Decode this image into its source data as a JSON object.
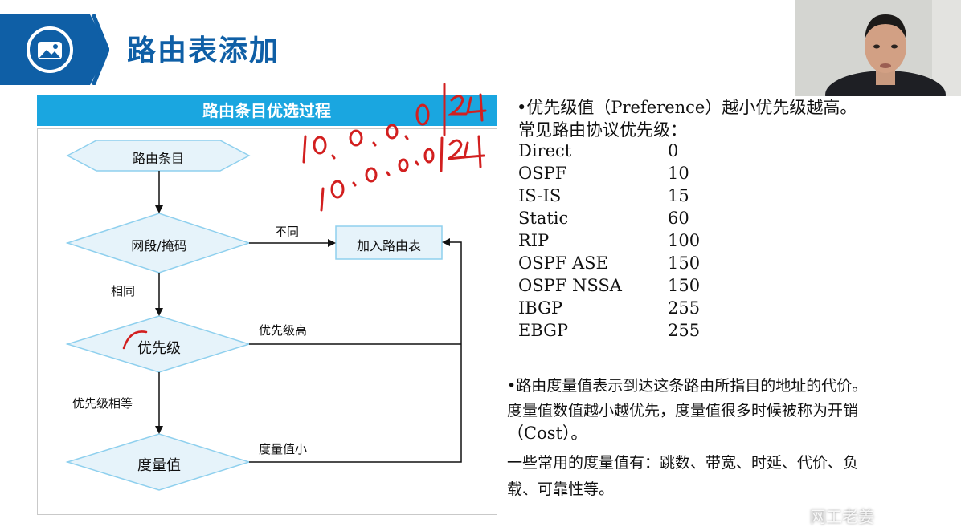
{
  "header": {
    "title": "路由表添加",
    "icon": "image-icon",
    "colors": {
      "bar": "#0f5fa6",
      "title": "#0f5fa6"
    }
  },
  "flowchart": {
    "title": "路由条目优选过程",
    "nodes": {
      "route_entry": "路由条目",
      "segment_mask": "网段/掩码",
      "add_table": "加入路由表",
      "priority": "优先级",
      "metric": "度量值"
    },
    "edges": {
      "different": "不同",
      "same": "相同",
      "priority_high": "优先级高",
      "priority_equal": "优先级相等",
      "metric_small": "度量值小"
    },
    "colors": {
      "header": "#1aa6e0",
      "node_fill": "#e6f3fa",
      "node_stroke": "#8fd0ee"
    }
  },
  "annotations": {
    "line1": "10.0.0.0/24",
    "line2": "10.0.0.0/24",
    "color": "#d21f1f"
  },
  "right": {
    "pref_intro": "•优先级值（Preference）越小优先级越高。",
    "common_title": "常见路由协议优先级：",
    "protocols": [
      {
        "name": "Direct",
        "value": "0"
      },
      {
        "name": "OSPF",
        "value": "10"
      },
      {
        "name": "IS-IS",
        "value": "15"
      },
      {
        "name": "Static",
        "value": "60"
      },
      {
        "name": "RIP",
        "value": "100"
      },
      {
        "name": "OSPF ASE",
        "value": "150"
      },
      {
        "name": "OSPF NSSA",
        "value": "150"
      },
      {
        "name": "IBGP",
        "value": "255"
      },
      {
        "name": "EBGP",
        "value": "255"
      }
    ],
    "metric_line1": "•路由度量值表示到达这条路由所指目的地址的代价。",
    "metric_line2": "度量值数值越小越优先，度量值很多时候被称为开销",
    "metric_line3": "（Cost）。",
    "common_metric_line1": "一些常用的度量值有：跳数、带宽、时延、代价、负",
    "common_metric_line2": "载、可靠性等。"
  },
  "watermark": "网工老姜"
}
